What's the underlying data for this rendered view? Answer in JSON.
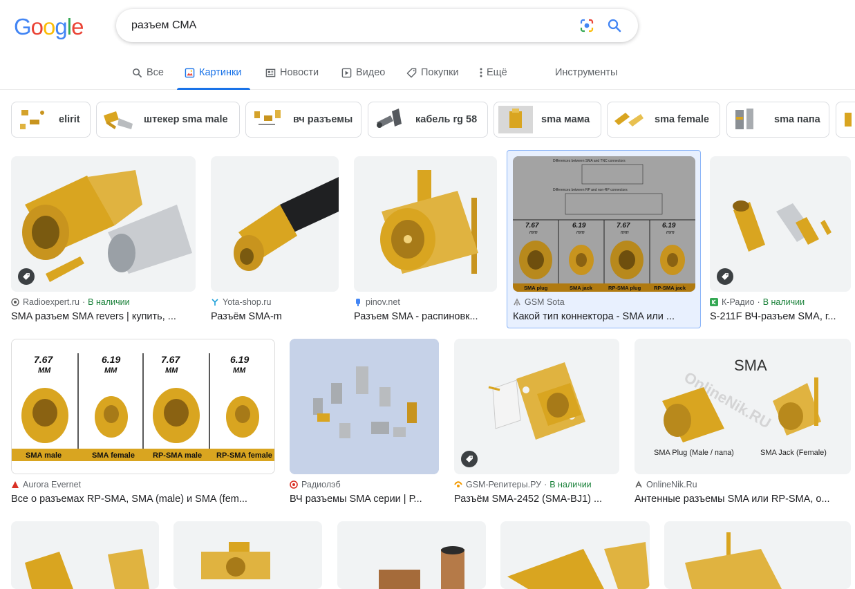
{
  "search": {
    "query": "разъем СМА"
  },
  "logo": {
    "letters": [
      "G",
      "o",
      "o",
      "g",
      "l",
      "e"
    ],
    "colors": [
      "#4285F4",
      "#EA4335",
      "#FBBC05",
      "#4285F4",
      "#34A853",
      "#EA4335"
    ]
  },
  "tabs": [
    {
      "label": "Все",
      "icon": "search-icon"
    },
    {
      "label": "Картинки",
      "icon": "image-icon",
      "active": true
    },
    {
      "label": "Новости",
      "icon": "news-icon"
    },
    {
      "label": "Видео",
      "icon": "video-icon"
    },
    {
      "label": "Покупки",
      "icon": "tag-icon"
    },
    {
      "label": "Ещё",
      "icon": "more-vert-icon"
    },
    {
      "label": "Инструменты"
    }
  ],
  "chips": [
    {
      "label": "elirit"
    },
    {
      "label": "штекер sma male"
    },
    {
      "label": "вч разъемы"
    },
    {
      "label": "кабель rg 58"
    },
    {
      "label": "sma мама"
    },
    {
      "label": "sma female"
    },
    {
      "label": "sma папа"
    }
  ],
  "results": [
    {
      "source": "Radioexpert.ru",
      "stock": "В наличии",
      "title": "SMA разъем SMA revers | купить, ..."
    },
    {
      "source": "Yota-shop.ru",
      "title": "Разъём SMA-m"
    },
    {
      "source": "pinov.net",
      "title": "Разъем SMA - распиновк..."
    },
    {
      "source": "GSM Sota",
      "title": "Какой тип коннектора - SMA или ..."
    },
    {
      "source": "К-Радио",
      "stock": "В наличии",
      "title": "S-211F ВЧ-разъем SMA, г..."
    },
    {
      "source": "Aurora Evernet",
      "title": "Все о разъемах RP-SMA, SMA (male) и SMA (fem..."
    },
    {
      "source": "Радиолэб",
      "title": "ВЧ разъемы SMA серии | Р..."
    },
    {
      "source": "GSM-Репитеры.РУ",
      "stock": "В наличии",
      "title": "Разъём SMA-2452 (SMA-BJ1) ..."
    },
    {
      "source": "OnlineNik.Ru",
      "title": "Антенные разъемы SMA или RP-SMA, о..."
    }
  ],
  "image_text": {
    "dims": [
      "7.67",
      "6.19",
      "7.67",
      "6.19"
    ],
    "unit": "MM",
    "unit_small": "mm",
    "types": [
      "SMA male",
      "SMA female",
      "RP-SMA male",
      "RP-SMA female"
    ],
    "types_gsm": [
      "SMA plug",
      "SMA jack",
      "RP-SMA plug",
      "RP-SMA jack"
    ],
    "sma_title": "SMA",
    "sma_plug": "SMA Plug (Male / папа)",
    "sma_jack": "SMA Jack (Female)",
    "watermark": "OnlineNik.RU",
    "table_h1": "Differences between SMA and TNC connectors",
    "table_h2": "Differences between RP and non-RP connectors"
  },
  "colors": {
    "accent": "#1a73e8",
    "stock_green": "#188038",
    "gold": "#d9a520"
  }
}
